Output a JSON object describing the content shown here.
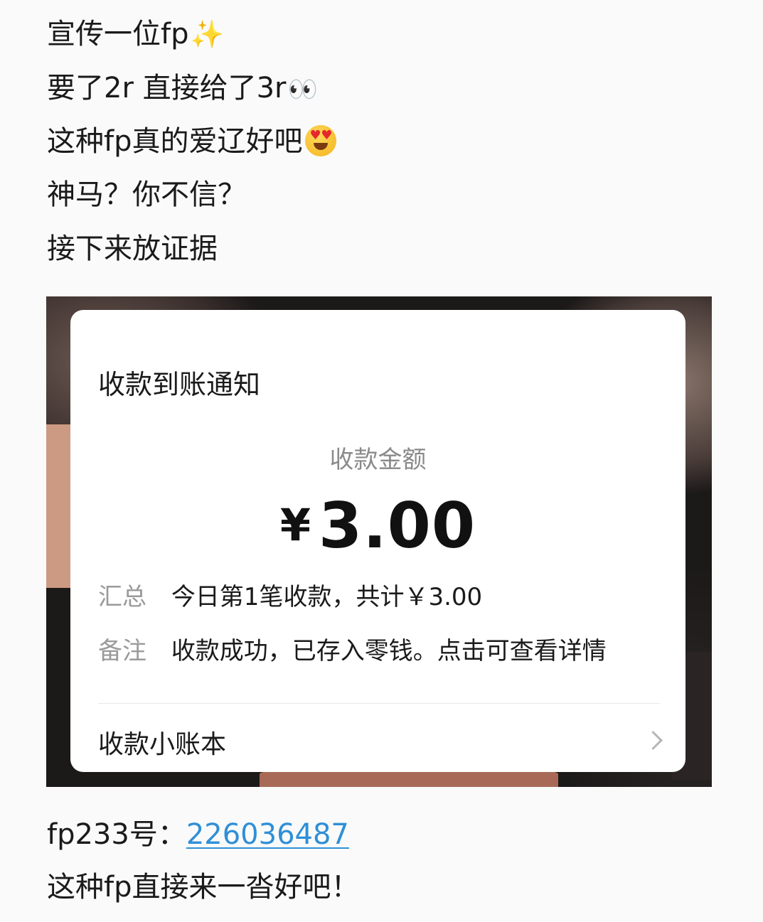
{
  "post": {
    "lines": [
      "宣传一位fp",
      "要了2r 直接给了3r",
      "这种fp真的爱辽好吧",
      "神马？你不信？",
      "接下来放证据"
    ],
    "emojis": {
      "line1": "✨",
      "line2": "👀",
      "line3": "smiling-face-with-heart-eyes"
    }
  },
  "receipt": {
    "title": "收款到账通知",
    "amount_label": "收款金额",
    "currency": "¥",
    "amount": "3.00",
    "summary_key": "汇总",
    "summary_value": "今日第1笔收款，共计￥3.00",
    "remark_key": "备注",
    "remark_value": "收款成功，已存入零钱。点击可查看详情",
    "ledger_label": "收款小账本"
  },
  "footer": {
    "id_prefix": "fp233号：",
    "id_number": "226036487",
    "closing": "这种fp直接来一沓好吧！"
  },
  "colors": {
    "link": "#2f8fd6",
    "muted_text": "#9a9a9a",
    "background": "#fafafa"
  }
}
